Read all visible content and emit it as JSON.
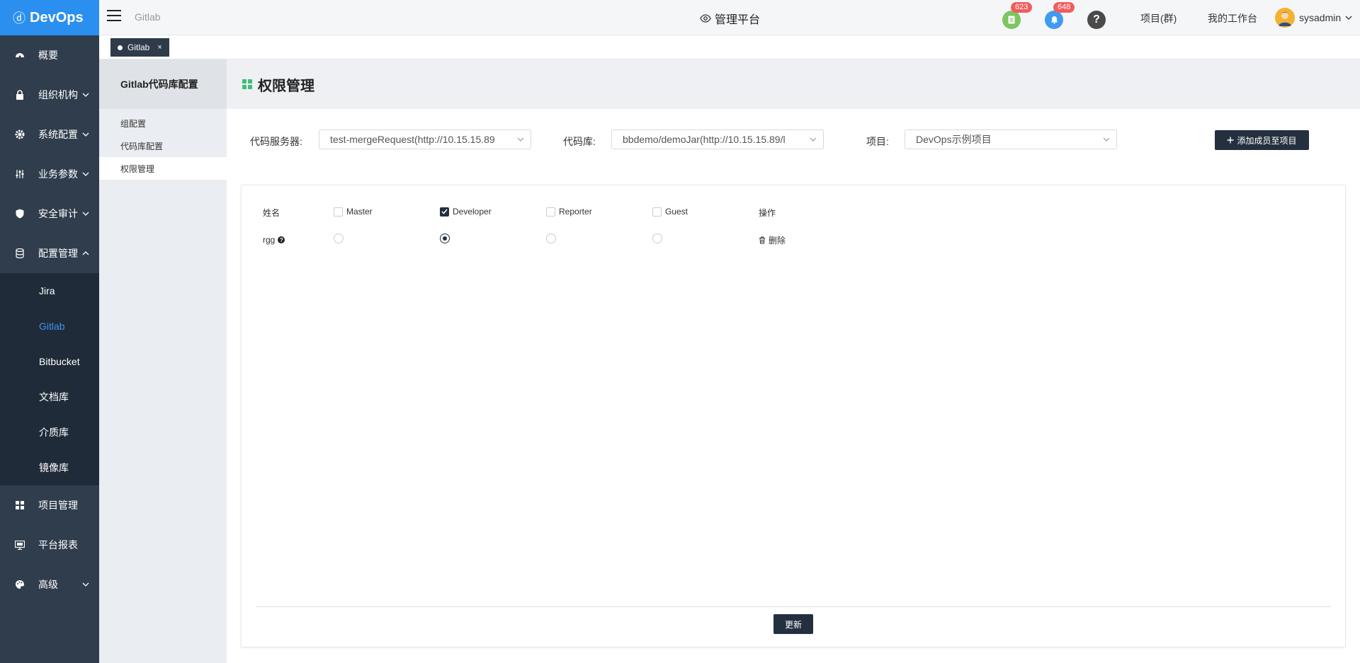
{
  "app": {
    "brand": "DevOps"
  },
  "sidebar": {
    "items": [
      {
        "label": "概要",
        "icon": "dashboard-icon"
      },
      {
        "label": "组织机构",
        "icon": "lock-icon"
      },
      {
        "label": "系统配置",
        "icon": "gear-icon"
      },
      {
        "label": "业务参数",
        "icon": "sliders-icon"
      },
      {
        "label": "安全审计",
        "icon": "shield-icon"
      },
      {
        "label": "配置管理",
        "icon": "database-icon"
      },
      {
        "label": "项目管理",
        "icon": "grid-icon"
      },
      {
        "label": "平台报表",
        "icon": "monitor-icon"
      },
      {
        "label": "高级",
        "icon": "palette-icon"
      }
    ],
    "config_submenu": [
      "Jira",
      "Gitlab",
      "Bitbucket",
      "文档库",
      "介质库",
      "镜像库"
    ]
  },
  "header": {
    "crumb": "Gitlab",
    "platform": "管理平台",
    "tasks_badge": "623",
    "notify_badge": "648",
    "projects_link": "项目(群)",
    "workspace_link": "我的工作台",
    "username": "sysadmin"
  },
  "tabs": [
    {
      "label": "Gitlab",
      "close": "×"
    }
  ],
  "subnav": {
    "title": "Gitlab代码库配置",
    "items": [
      "组配置",
      "代码库配置",
      "权限管理"
    ]
  },
  "page": {
    "title": "权限管理"
  },
  "filters": {
    "server_label": "代码服务器:",
    "server_value": "test-mergeRequest(http://10.15.15.89",
    "repo_label": "代码库:",
    "repo_value": "bbdemo/demoJar(http://10.15.15.89/l",
    "project_label": "项目:",
    "project_value": "DevOps示例项目",
    "add_button": "添加成员至项目"
  },
  "table": {
    "headers": {
      "name": "姓名",
      "master": "Master",
      "developer": "Developer",
      "reporter": "Reporter",
      "guest": "Guest",
      "action": "操作"
    },
    "rows": [
      {
        "name": "rgg",
        "role": "Developer",
        "delete": "删除"
      }
    ]
  },
  "actions": {
    "update": "更新"
  },
  "colors": {
    "brand": "#2b8ff0",
    "sidebar": "#2f3d4d",
    "active": "#3e95ee",
    "primary_button": "#24303f",
    "badge": "#f15c5c"
  }
}
